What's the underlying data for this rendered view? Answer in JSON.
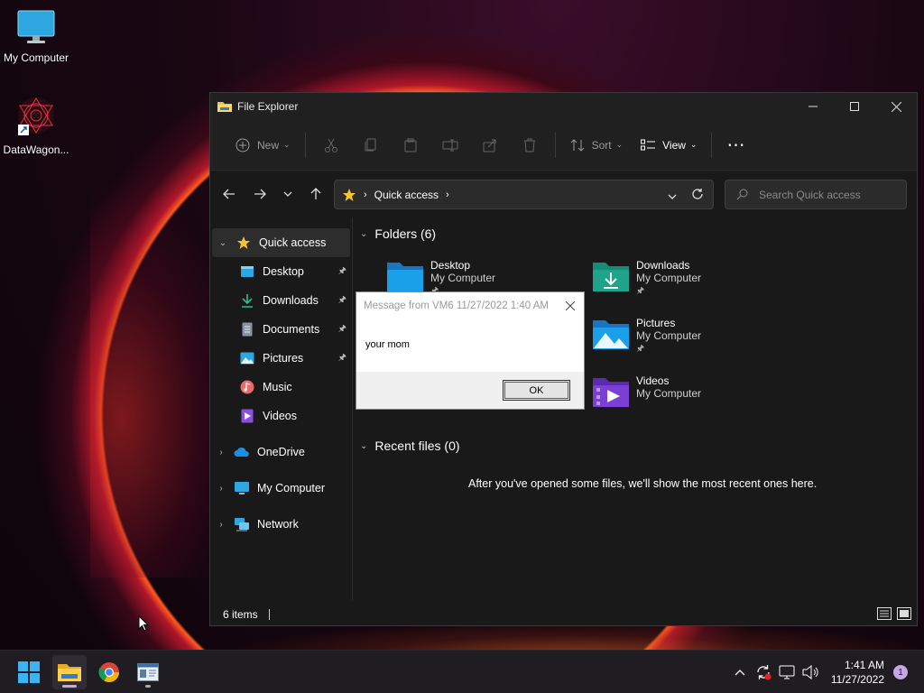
{
  "desktop": {
    "icons": [
      {
        "label": "My Computer"
      },
      {
        "label": "DataWagon..."
      }
    ]
  },
  "window": {
    "title": "File Explorer",
    "toolbar": {
      "new_label": "New",
      "sort_label": "Sort",
      "view_label": "View"
    },
    "address": {
      "crumb": "Quick access"
    },
    "search": {
      "placeholder": "Search Quick access"
    },
    "sidebar": {
      "quick_access": "Quick access",
      "pinned": [
        {
          "label": "Desktop"
        },
        {
          "label": "Downloads"
        },
        {
          "label": "Documents"
        },
        {
          "label": "Pictures"
        },
        {
          "label": "Music"
        },
        {
          "label": "Videos"
        }
      ],
      "onedrive": "OneDrive",
      "my_computer": "My Computer",
      "network": "Network"
    },
    "content": {
      "folders_header": "Folders (6)",
      "folders": [
        {
          "name": "Desktop",
          "location": "My Computer"
        },
        {
          "name": "Downloads",
          "location": "My Computer"
        },
        {
          "name": "Pictures",
          "location": "My Computer"
        },
        {
          "name": "Videos",
          "location": "My Computer"
        }
      ],
      "recent_header": "Recent files (0)",
      "recent_empty": "After you've opened some files, we'll show the most recent ones here."
    },
    "status": {
      "items": "6 items"
    }
  },
  "dialog": {
    "title": "Message from VM6 11/27/2022 1:40 AM",
    "message": "your mom",
    "ok_label": "OK"
  },
  "taskbar": {
    "time": "1:41 AM",
    "date": "11/27/2022",
    "notifications": "1"
  },
  "colors": {
    "accent": "#0078d7",
    "folder_blue": "#1aa0e8",
    "downloads_teal": "#1fa38a",
    "videos_purple": "#7b3fd6"
  }
}
